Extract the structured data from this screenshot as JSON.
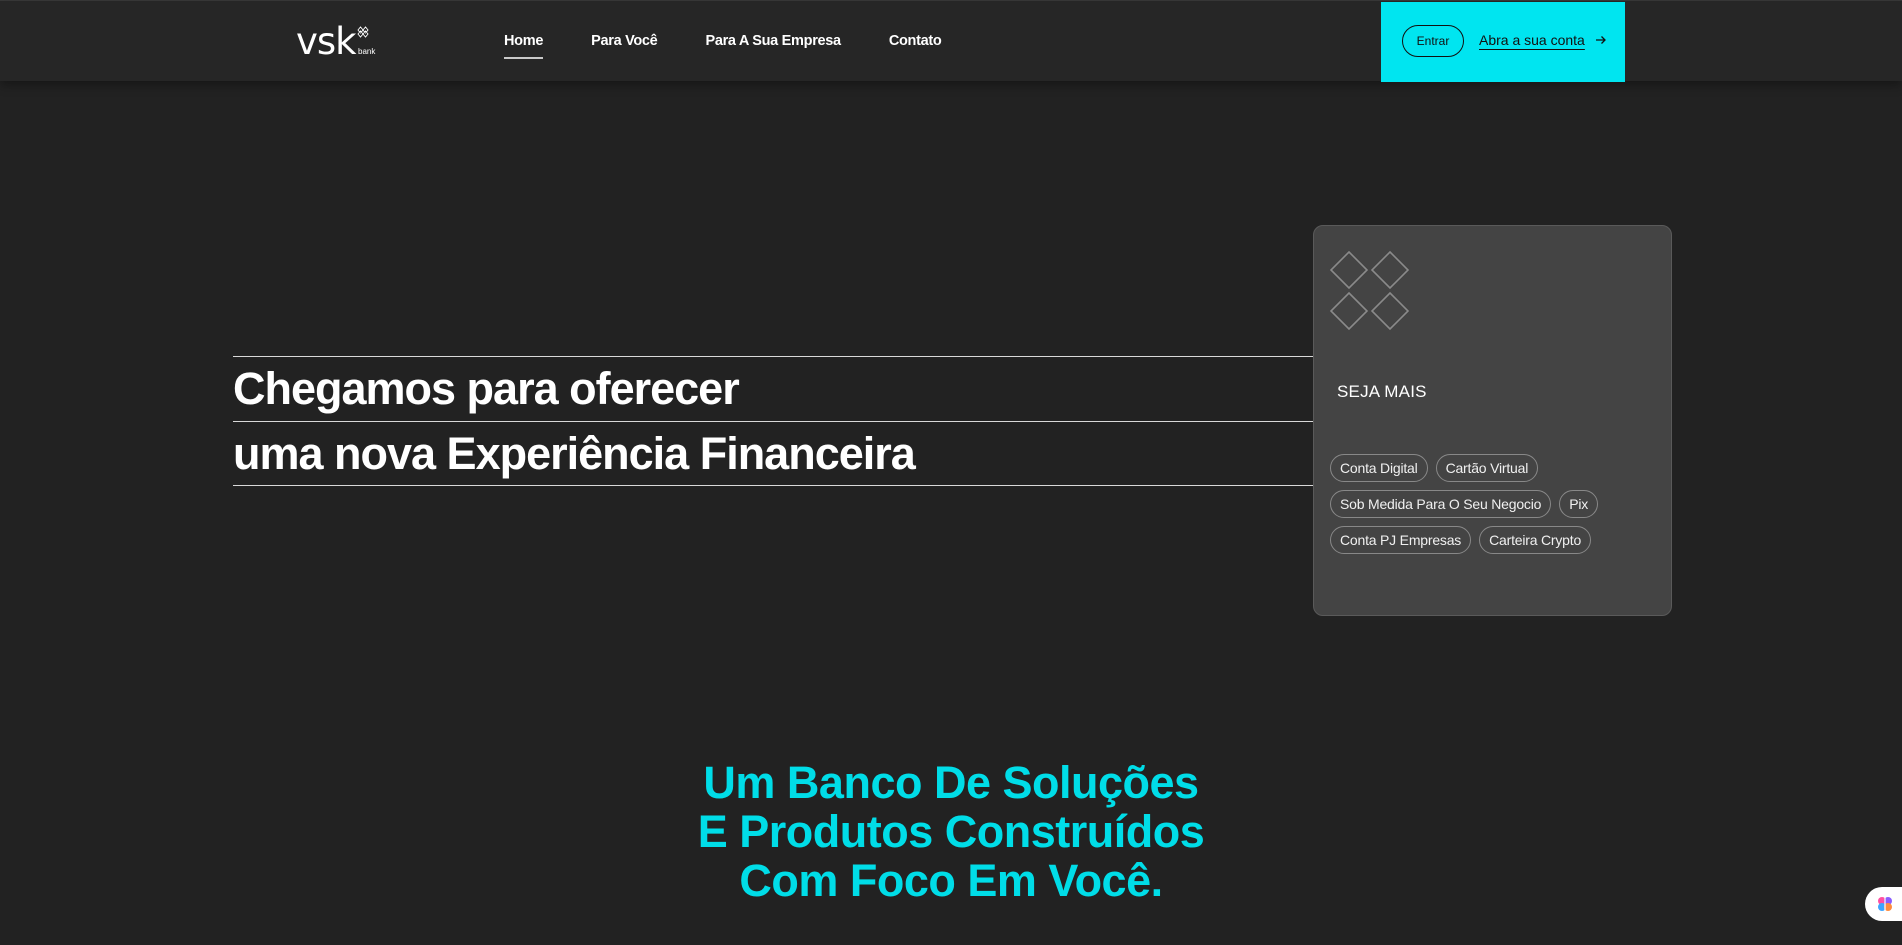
{
  "brand": {
    "name": "vsk",
    "sub": "bank",
    "accent": "#00e5f0",
    "headline_color": "#00dde8"
  },
  "nav": {
    "items": [
      "Home",
      "Para Você",
      "Para A Sua Empresa",
      "Contato"
    ],
    "active": "Home"
  },
  "cta": {
    "login_label": "Entrar",
    "open_account_label": "Abra a sua conta",
    "arrow_icon": "arrow-right-icon"
  },
  "hero": {
    "line1": "Chegamos para oferecer",
    "line2": "uma nova Experiência Financeira"
  },
  "card": {
    "symbol_icon": "double-diamond-icon",
    "title": "SEJA MAIS",
    "chips": [
      "Conta Digital",
      "Cartão Virtual",
      "Sob Medida Para O Seu Negocio",
      "Pix",
      "Conta PJ Empresas",
      "Carteira Crypto"
    ]
  },
  "solutions": {
    "line1": "Um Banco De Soluções",
    "line2": "E Produtos Construídos",
    "line3": "Com Foco Em Você."
  },
  "floating": {
    "icon": "brain-icon"
  }
}
